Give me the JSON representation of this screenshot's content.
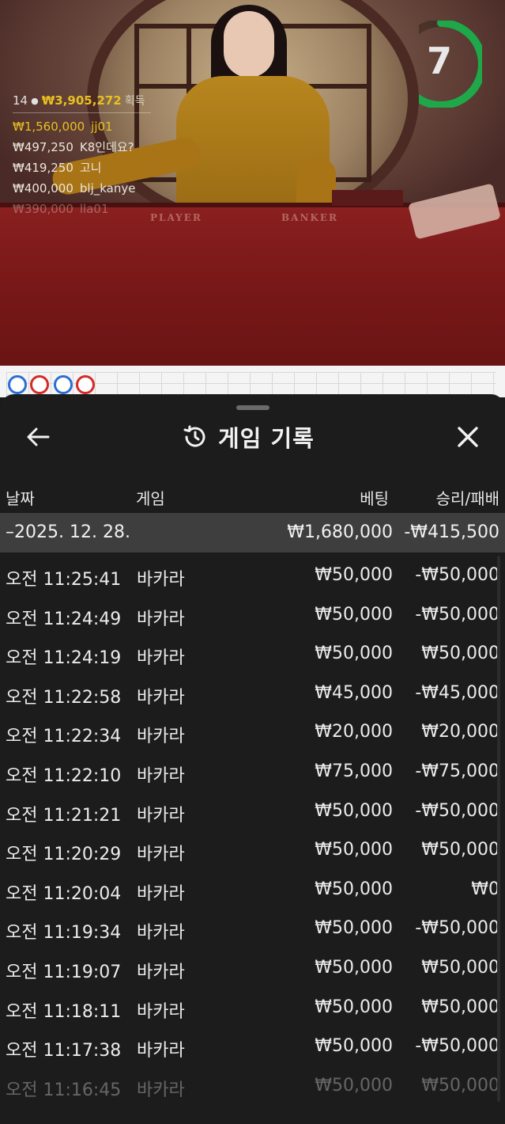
{
  "video": {
    "table_labels": {
      "player": "PLAYER",
      "banker": "BANKER"
    },
    "timer": {
      "seconds": "7",
      "progress": 0.7,
      "color": "#1fa84a"
    }
  },
  "winners": {
    "count": "14",
    "total": "₩3,905,272",
    "total_label": "획득",
    "list": [
      {
        "amount": "₩1,560,000",
        "name": "jj01"
      },
      {
        "amount": "₩497,250",
        "name": "K8인데요?"
      },
      {
        "amount": "₩419,250",
        "name": "고니"
      },
      {
        "amount": "₩400,000",
        "name": "blj_kanye"
      },
      {
        "amount": "₩390,000",
        "name": "lla01"
      }
    ]
  },
  "sheet": {
    "title": "게임 기록",
    "icons": {
      "back": "arrow-left-icon",
      "history": "history-clock-icon",
      "close": "close-icon"
    },
    "columns": {
      "date": "날짜",
      "game": "게임",
      "bet": "베팅",
      "result": "승리/패배"
    },
    "date_group": {
      "date": "2025. 12. 28.",
      "bet": "₩1,680,000",
      "result": "-₩415,500"
    },
    "rows": [
      {
        "time": "오전 11:25:41",
        "game": "바카라",
        "bet": "₩50,000",
        "result": "-₩50,000"
      },
      {
        "time": "오전 11:24:49",
        "game": "바카라",
        "bet": "₩50,000",
        "result": "-₩50,000"
      },
      {
        "time": "오전 11:24:19",
        "game": "바카라",
        "bet": "₩50,000",
        "result": "₩50,000"
      },
      {
        "time": "오전 11:22:58",
        "game": "바카라",
        "bet": "₩45,000",
        "result": "-₩45,000"
      },
      {
        "time": "오전 11:22:34",
        "game": "바카라",
        "bet": "₩20,000",
        "result": "₩20,000"
      },
      {
        "time": "오전 11:22:10",
        "game": "바카라",
        "bet": "₩75,000",
        "result": "-₩75,000"
      },
      {
        "time": "오전 11:21:21",
        "game": "바카라",
        "bet": "₩50,000",
        "result": "-₩50,000"
      },
      {
        "time": "오전 11:20:29",
        "game": "바카라",
        "bet": "₩50,000",
        "result": "₩50,000"
      },
      {
        "time": "오전 11:20:04",
        "game": "바카라",
        "bet": "₩50,000",
        "result": "₩0"
      },
      {
        "time": "오전 11:19:34",
        "game": "바카라",
        "bet": "₩50,000",
        "result": "-₩50,000"
      },
      {
        "time": "오전 11:19:07",
        "game": "바카라",
        "bet": "₩50,000",
        "result": "₩50,000"
      },
      {
        "time": "오전 11:18:11",
        "game": "바카라",
        "bet": "₩50,000",
        "result": "₩50,000"
      },
      {
        "time": "오전 11:17:38",
        "game": "바카라",
        "bet": "₩50,000",
        "result": "-₩50,000"
      },
      {
        "time": "오전 11:16:45",
        "game": "바카라",
        "bet": "₩50,000",
        "result": "₩50,000"
      }
    ]
  }
}
